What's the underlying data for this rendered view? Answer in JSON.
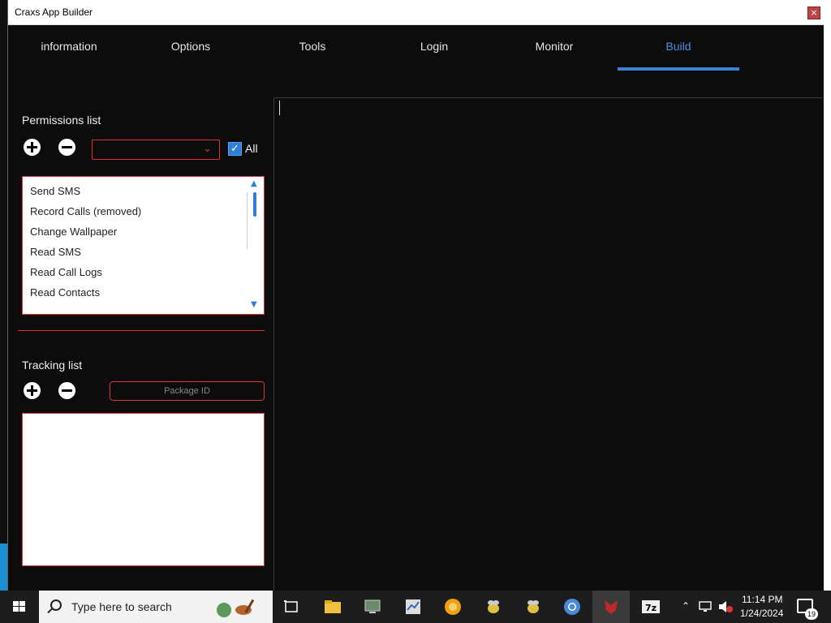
{
  "window": {
    "title": "Craxs App Builder",
    "close_glyph": "×"
  },
  "tabs": [
    {
      "label": "information"
    },
    {
      "label": "Options"
    },
    {
      "label": "Tools"
    },
    {
      "label": "Login"
    },
    {
      "label": "Monitor"
    },
    {
      "label": "Build",
      "active": true
    }
  ],
  "permissions": {
    "label": "Permissions list",
    "select_value": "",
    "all_checked": true,
    "all_label": "All",
    "items": [
      "Send SMS",
      "Record Calls (removed)",
      "Change Wallpaper",
      "Read SMS",
      "Read Call Logs",
      "Read Contacts"
    ]
  },
  "tracking": {
    "label": "Tracking list",
    "package_placeholder": "Package ID"
  },
  "taskbar": {
    "search_placeholder": "Type here to search",
    "clock_time": "11:14 PM",
    "clock_date": "1/24/2024",
    "notification_count": "19"
  },
  "colors": {
    "accent_blue": "#3c82d6",
    "border_red": "#dd3333",
    "background": "#0c0c0c"
  },
  "icons": {
    "add": "plus-circle-icon",
    "remove": "minus-circle-icon",
    "dropdown": "chevron-down-icon",
    "search": "search-icon"
  }
}
